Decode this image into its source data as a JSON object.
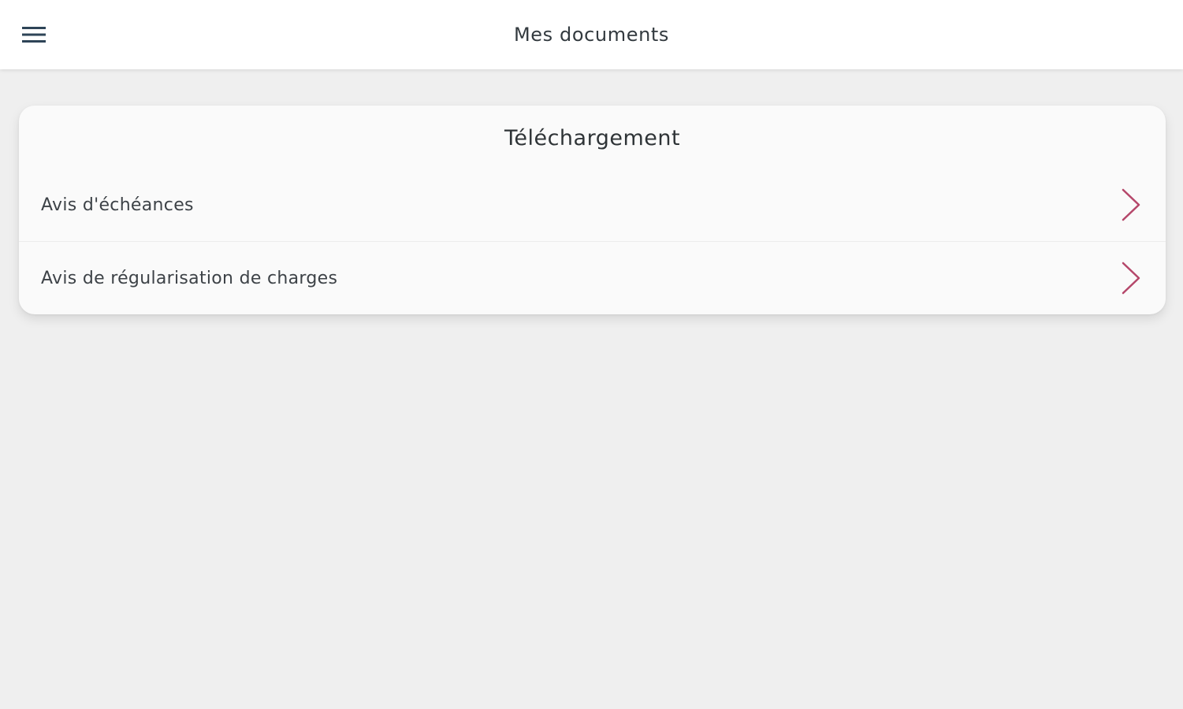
{
  "header": {
    "menu_icon": "hamburger-menu-icon",
    "title": "Mes documents"
  },
  "download_section": {
    "heading": "Téléchargement",
    "items": [
      {
        "label": "Avis d'échéances",
        "icon": "chevron-right-icon"
      },
      {
        "label": "Avis de régularisation de charges",
        "icon": "chevron-right-icon"
      }
    ]
  },
  "colors": {
    "background": "#efefef",
    "card": "#fafafa",
    "chevron": "#b5476a",
    "menu_icon": "#2e4457",
    "text": "#333a3f"
  }
}
